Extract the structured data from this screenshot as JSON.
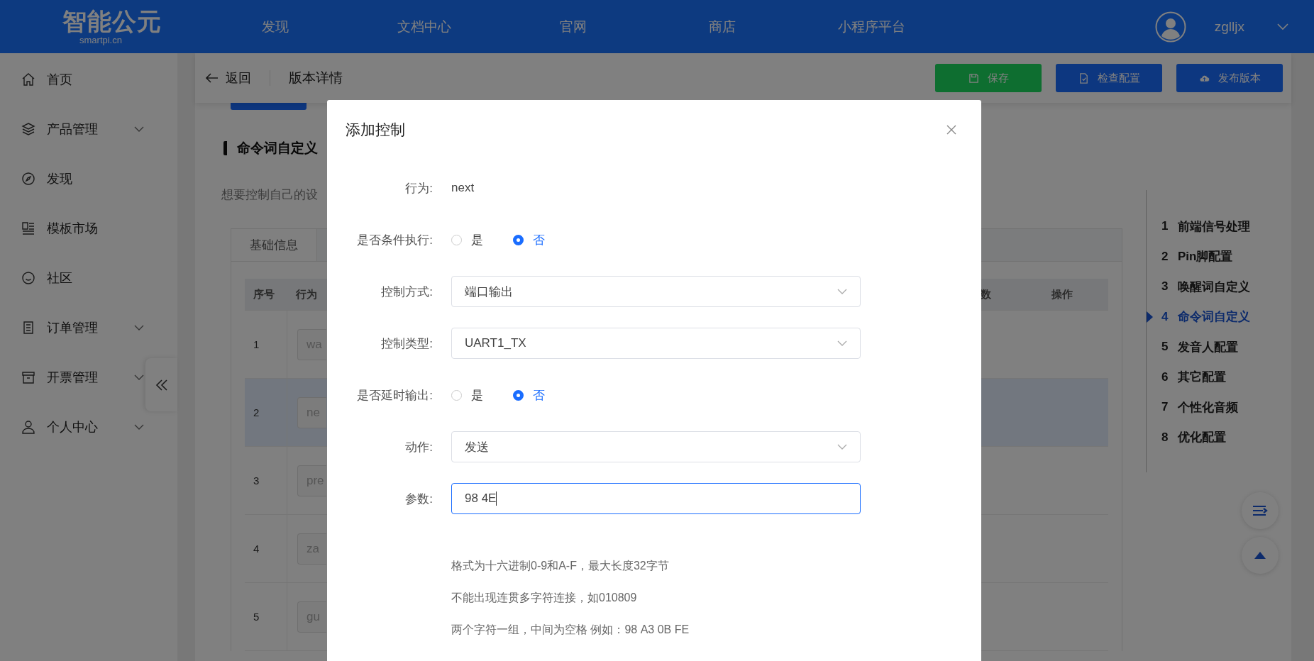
{
  "topbar": {
    "logo": {
      "title": "智能公元",
      "subtitle": "smartpi.cn"
    },
    "nav": [
      {
        "label": "发现"
      },
      {
        "label": "文档中心"
      },
      {
        "label": "官网"
      },
      {
        "label": "商店"
      },
      {
        "label": "小程序平台"
      }
    ],
    "user": {
      "name": "zglljx"
    }
  },
  "sidebar": {
    "items": [
      {
        "label": "首页",
        "expandable": false
      },
      {
        "label": "产品管理",
        "expandable": true
      },
      {
        "label": "发现",
        "expandable": false
      },
      {
        "label": "模板市场",
        "expandable": false
      },
      {
        "label": "社区",
        "expandable": false
      },
      {
        "label": "订单管理",
        "expandable": true
      },
      {
        "label": "开票管理",
        "expandable": true
      },
      {
        "label": "个人中心",
        "expandable": true
      }
    ]
  },
  "header": {
    "back": "返回",
    "title": "版本详情",
    "buttons": [
      {
        "label": "保存",
        "kind": "save"
      },
      {
        "label": "检查配置",
        "kind": "check"
      },
      {
        "label": "发布版本",
        "kind": "publish"
      }
    ]
  },
  "section": {
    "title": "命令词自定义",
    "description": "想要控制自己的设",
    "tabs": [
      {
        "label": "基础信息",
        "selected": true
      }
    ],
    "table": {
      "columns": [
        "序号",
        "行为",
        "数",
        "操作"
      ],
      "rows": [
        {
          "index": "1",
          "action": "wa",
          "selected": false
        },
        {
          "index": "2",
          "action": "ne",
          "selected": true
        },
        {
          "index": "3",
          "action": "pre",
          "selected": false
        },
        {
          "index": "4",
          "action": "za",
          "selected": false
        },
        {
          "index": "5",
          "action": "gu",
          "selected": false
        }
      ]
    }
  },
  "steps": [
    {
      "number": "1",
      "label": "前端信号处理",
      "selected": false
    },
    {
      "number": "2",
      "label": "Pin脚配置",
      "selected": false
    },
    {
      "number": "3",
      "label": "唤醒词自定义",
      "selected": false
    },
    {
      "number": "4",
      "label": "命令词自定义",
      "selected": true
    },
    {
      "number": "5",
      "label": "发音人配置",
      "selected": false
    },
    {
      "number": "6",
      "label": "其它配置",
      "selected": false
    },
    {
      "number": "7",
      "label": "个性化音频",
      "selected": false
    },
    {
      "number": "8",
      "label": "优化配置",
      "selected": false
    }
  ],
  "modal": {
    "title": "添加控制",
    "fields": [
      {
        "kind": "text",
        "label": "行为:",
        "value": "next"
      },
      {
        "kind": "radio",
        "label": "是否条件执行:",
        "options": [
          {
            "label": "是",
            "selected": false
          },
          {
            "label": "否",
            "selected": true
          }
        ]
      },
      {
        "kind": "select",
        "label": "控制方式:",
        "value": "端口输出"
      },
      {
        "kind": "select",
        "label": "控制类型:",
        "value": "UART1_TX"
      },
      {
        "kind": "radio",
        "label": "是否延时输出:",
        "options": [
          {
            "label": "是",
            "selected": false
          },
          {
            "label": "否",
            "selected": true
          }
        ]
      },
      {
        "kind": "select",
        "label": "动作:",
        "value": "发送"
      },
      {
        "kind": "input",
        "label": "参数:",
        "value": "98 4E",
        "focused": true
      }
    ],
    "hints": [
      "格式为十六进制0-9和A-F，最大长度32字节",
      "不能出现连贯多字符连接，如010809",
      "两个字符一组，中间为空格 例如：98 A3 0B FE"
    ]
  }
}
